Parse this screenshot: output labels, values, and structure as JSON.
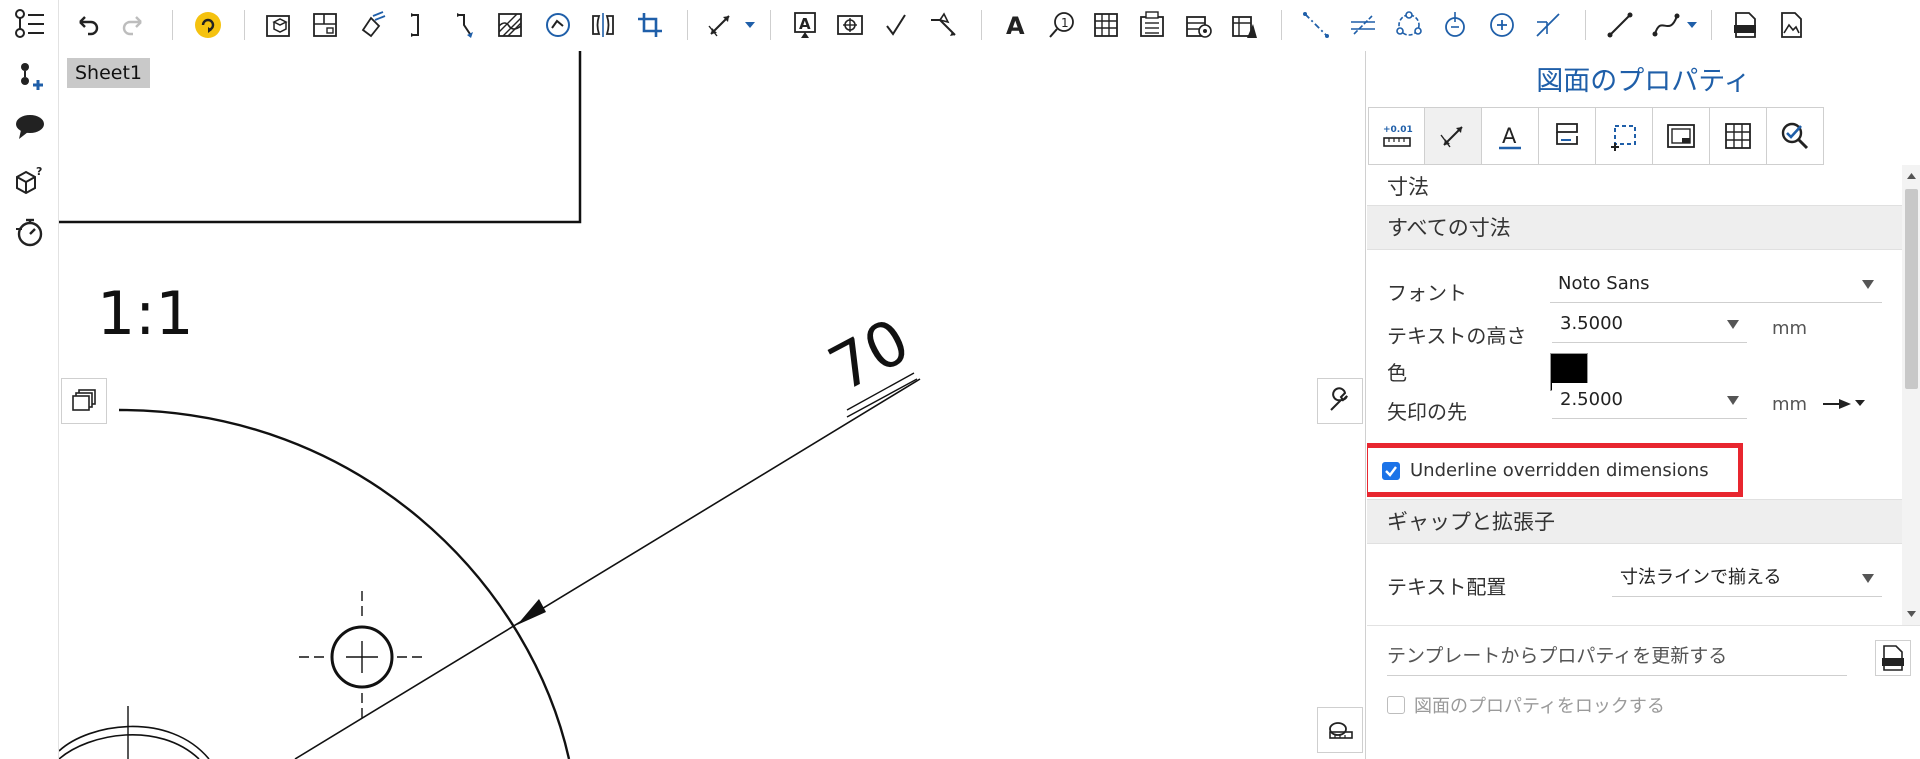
{
  "toolbar": {
    "tools": [
      {
        "icon": "undo-icon"
      },
      {
        "icon": "redo-icon"
      },
      {
        "icon": "update-icon"
      },
      {
        "icon": "insert-view-icon"
      },
      {
        "icon": "projected-view-icon"
      },
      {
        "icon": "auxiliary-view-icon"
      },
      {
        "icon": "section-view-icon"
      },
      {
        "icon": "aligned-section-icon"
      },
      {
        "icon": "broken-out-section-icon"
      },
      {
        "icon": "detail-view-icon"
      },
      {
        "icon": "break-view-icon"
      },
      {
        "icon": "crop-view-icon"
      },
      {
        "icon": "dimension-icon"
      },
      {
        "icon": "note-icon"
      },
      {
        "icon": "feature-control-frame-icon"
      },
      {
        "icon": "surface-finish-icon"
      },
      {
        "icon": "weld-symbol-icon"
      },
      {
        "icon": "text-icon"
      },
      {
        "icon": "callout-icon"
      },
      {
        "icon": "table-icon"
      },
      {
        "icon": "bom-table-icon"
      },
      {
        "icon": "hole-table-icon"
      },
      {
        "icon": "revision-table-icon"
      },
      {
        "icon": "centerline-icon"
      },
      {
        "icon": "centermark-icon"
      },
      {
        "icon": "bolt-circle-icon"
      },
      {
        "icon": "point-centermark-icon"
      },
      {
        "icon": "circle-centermark-icon"
      },
      {
        "icon": "chamfer-icon"
      },
      {
        "icon": "line-icon"
      },
      {
        "icon": "spline-icon"
      },
      {
        "icon": "export-dxf-icon"
      },
      {
        "icon": "insert-image-icon"
      }
    ]
  },
  "leftbar": {
    "items": [
      {
        "icon": "feature-list-icon"
      },
      {
        "icon": "add-point-icon"
      },
      {
        "icon": "comment-icon"
      },
      {
        "icon": "parts-help-icon"
      },
      {
        "icon": "stopwatch-icon"
      }
    ]
  },
  "canvas": {
    "sheet_tab": "Sheet1",
    "scale": "1:1",
    "dimension_value": "70"
  },
  "panel": {
    "title": "図面のプロパティ",
    "tabs": [
      {
        "icon": "units-precision-icon"
      },
      {
        "icon": "dimension-tab-icon"
      },
      {
        "icon": "text-tab-icon"
      },
      {
        "icon": "annotation-tab-icon"
      },
      {
        "icon": "view-tab-icon"
      },
      {
        "icon": "sheet-tab-icon"
      },
      {
        "icon": "table-tab-icon"
      },
      {
        "icon": "checker-tab-icon"
      }
    ],
    "active_tab": 1,
    "section_title": "寸法",
    "all_dimensions_header": "すべての寸法",
    "font_label": "フォント",
    "font_value": "Noto Sans",
    "text_height_label": "テキストの高さ",
    "text_height_value": "3.5000",
    "text_height_unit": "mm",
    "color_label": "色",
    "color_value": "#000000",
    "arrow_label": "矢印の先",
    "arrow_value": "2.5000",
    "arrow_unit": "mm",
    "underline_label": "Underline overridden dimensions",
    "underline_checked": true,
    "gap_header": "ギャップと拡張子",
    "text_align_label": "テキスト配置",
    "text_align_value": "寸法ラインで揃える",
    "update_from_template": "テンプレートからプロパティを更新する",
    "lock_props": "図面のプロパティをロックする",
    "lock_checked": false
  },
  "colors": {
    "accent": "#1f5fa9",
    "highlight": "#e8262f",
    "checkbox": "#1b73e8"
  }
}
